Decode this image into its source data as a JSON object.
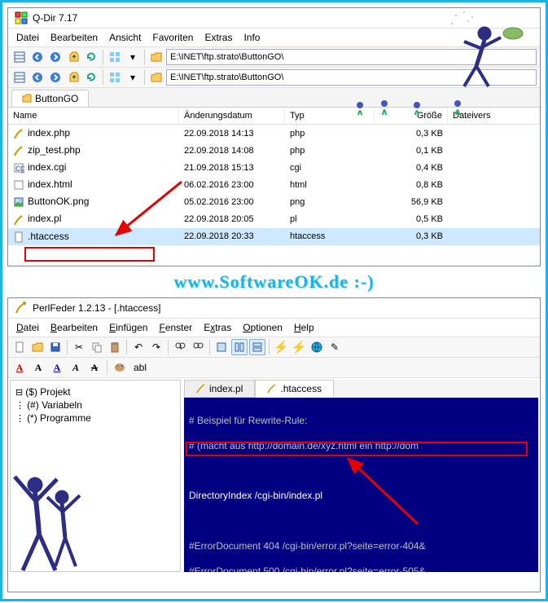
{
  "qdir": {
    "title": "Q-Dir 7.17",
    "menu": [
      "Datei",
      "Bearbeiten",
      "Ansicht",
      "Favoriten",
      "Extras",
      "Info"
    ],
    "path": "E:\\INET\\ftp.strato\\ButtonGO\\",
    "tab": "ButtonGO",
    "columns": {
      "name": "Name",
      "date": "Änderungsdatum",
      "type": "Typ",
      "size": "Größe",
      "extra": "Dateivers"
    },
    "files": [
      {
        "name": "index.php",
        "date": "22.09.2018 14:13",
        "type": "php",
        "size": "0,3 KB",
        "icon": "php"
      },
      {
        "name": "zip_test.php",
        "date": "22.09.2018 14:08",
        "type": "php",
        "size": "0,1 KB",
        "icon": "php"
      },
      {
        "name": "index.cgi",
        "date": "21.09.2018 15:13",
        "type": "cgi",
        "size": "0,4 KB",
        "icon": "cgi"
      },
      {
        "name": "index.html",
        "date": "06.02.2016 23:00",
        "type": "html",
        "size": "0,8 KB",
        "icon": "html"
      },
      {
        "name": "ButtonOK.png",
        "date": "05.02.2016 23:00",
        "type": "png",
        "size": "56,9 KB",
        "icon": "png"
      },
      {
        "name": "index.pl",
        "date": "22.09.2018 20:05",
        "type": "pl",
        "size": "0,5 KB",
        "icon": "pl"
      },
      {
        "name": ".htaccess",
        "date": "22.09.2018 20:33",
        "type": "htaccess",
        "size": "0,3 KB",
        "icon": "file",
        "selected": true
      }
    ]
  },
  "watermark": "www.SoftwareOK.de :-)",
  "perlfeder": {
    "title": "PerlFeder 1.2.13 - [.htaccess]",
    "menu": [
      "Datei",
      "Bearbeiten",
      "Einfügen",
      "Fenster",
      "Extras",
      "Optionen",
      "Help"
    ],
    "tree": [
      "($) Projekt",
      "(#) Variabeln",
      "(*) Programme"
    ],
    "tabs": [
      {
        "label": "index.pl",
        "active": false
      },
      {
        "label": ".htaccess",
        "active": true
      }
    ],
    "code": {
      "l1": "# Beispiel für Rewrite-Rule:",
      "l2": "# (macht aus http://domain.de/xyz.html ein http://dom",
      "l3": "DirectoryIndex /cgi-bin/index.pl",
      "l4": "#ErrorDocument 404 /cgi-bin/error.pl?seite=error-404&",
      "l5": "#ErrorDocument 500 /cgi-bin/error.pl?seite=error-505&"
    },
    "abl_label": "abl"
  }
}
